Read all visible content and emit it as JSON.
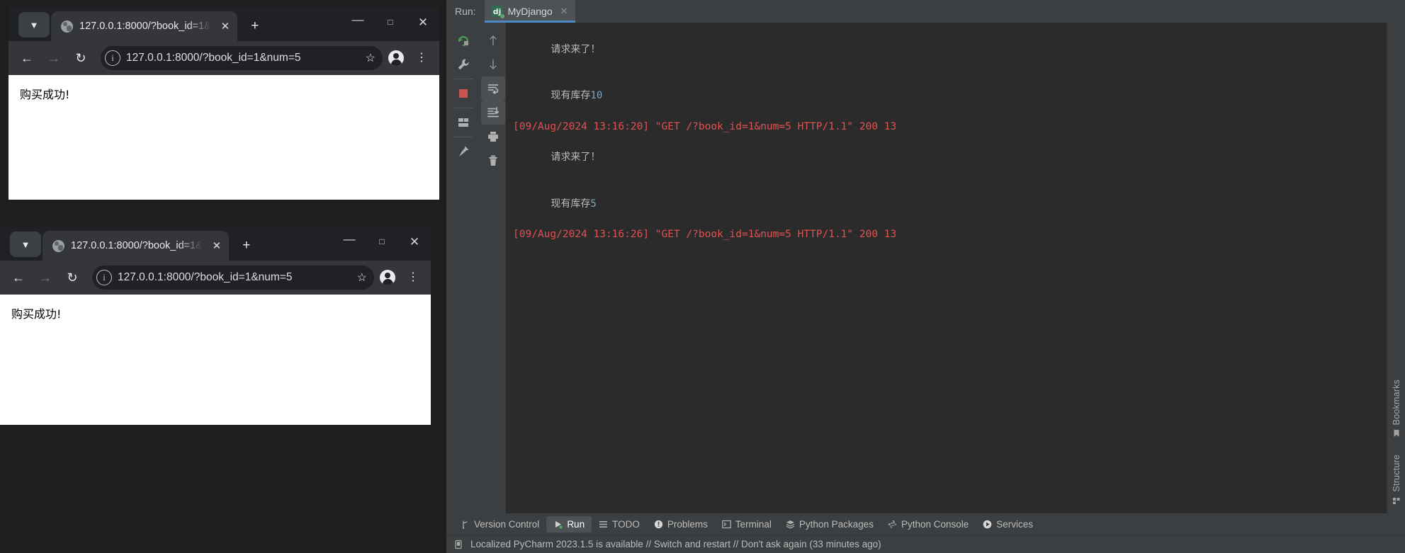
{
  "browsers": [
    {
      "tab": {
        "title": "127.0.0.1:8000/?book_id=1&",
        "favicon": "globe-icon",
        "close": "✕"
      },
      "new_tab": "+",
      "window_controls": {
        "minimize": "—",
        "maximize": "□",
        "close": "✕"
      },
      "nav": {
        "back": "←",
        "forward": "→",
        "reload": "↻"
      },
      "omnibox": {
        "info_icon": "i",
        "url": "127.0.0.1:8000/?book_id=1&num=5",
        "star": "☆"
      },
      "profile_icon": "avatar-icon",
      "menu_icon": "⋮",
      "page_text": "购买成功!"
    },
    {
      "tab": {
        "title": "127.0.0.1:8000/?book_id=1&",
        "favicon": "globe-icon",
        "close": "✕"
      },
      "new_tab": "+",
      "window_controls": {
        "minimize": "—",
        "maximize": "□",
        "close": "✕"
      },
      "nav": {
        "back": "←",
        "forward": "→",
        "reload": "↻"
      },
      "omnibox": {
        "info_icon": "i",
        "url": "127.0.0.1:8000/?book_id=1&num=5",
        "star": "☆"
      },
      "profile_icon": "avatar-icon",
      "menu_icon": "⋮",
      "page_text": "购买成功!"
    }
  ],
  "pycharm": {
    "run_label": "Run:",
    "run_tab": {
      "name": "MyDjango",
      "icon": "django-icon",
      "close": "✕"
    },
    "toolbar_left": [
      {
        "name": "rerun-icon"
      },
      {
        "name": "wrench-icon"
      },
      {
        "name": "stop-icon"
      },
      {
        "name": "layout-icon"
      },
      {
        "name": "pin-icon"
      }
    ],
    "toolbar_right": [
      {
        "name": "arrow-up-icon"
      },
      {
        "name": "arrow-down-icon"
      },
      {
        "name": "soft-wrap-icon"
      },
      {
        "name": "scroll-to-end-icon"
      },
      {
        "name": "print-icon"
      },
      {
        "name": "trash-icon"
      }
    ],
    "console": [
      {
        "type": "info",
        "text": "请求来了！",
        "num": ""
      },
      {
        "type": "info",
        "text": "现有库存",
        "num": "10"
      },
      {
        "type": "error",
        "text": "[09/Aug/2024 13:16:20] \"GET /?book_id=1&num=5 HTTP/1.1\" 200 13"
      },
      {
        "type": "info",
        "text": "请求来了！",
        "num": ""
      },
      {
        "type": "info",
        "text": "现有库存",
        "num": "5"
      },
      {
        "type": "error",
        "text": "[09/Aug/2024 13:16:26] \"GET /?book_id=1&num=5 HTTP/1.1\" 200 13"
      }
    ],
    "right_rail": [
      {
        "label": "Structure",
        "icon": "structure-icon"
      },
      {
        "label": "Bookmarks",
        "icon": "bookmark-icon"
      }
    ],
    "bottom_bar": [
      {
        "label": "Version Control",
        "icon": "branch-icon",
        "active": false
      },
      {
        "label": "Run",
        "icon": "play-icon",
        "active": true
      },
      {
        "label": "TODO",
        "icon": "list-icon",
        "active": false
      },
      {
        "label": "Problems",
        "icon": "warning-icon",
        "active": false
      },
      {
        "label": "Terminal",
        "icon": "terminal-icon",
        "active": false
      },
      {
        "label": "Python Packages",
        "icon": "packages-icon",
        "active": false
      },
      {
        "label": "Python Console",
        "icon": "python-icon",
        "active": false
      },
      {
        "label": "Services",
        "icon": "services-icon",
        "active": false
      }
    ],
    "status_bar": {
      "icon": "notification-icon",
      "text": "Localized PyCharm 2023.1.5 is available // Switch and restart // Don't ask again (33 minutes ago)"
    }
  },
  "colors": {
    "accent_blue": "#4a88c7",
    "error_red": "#e05252",
    "console_bg": "#2b2b2b",
    "ide_bg": "#3c3f41",
    "browser_chrome": "#35363a"
  }
}
